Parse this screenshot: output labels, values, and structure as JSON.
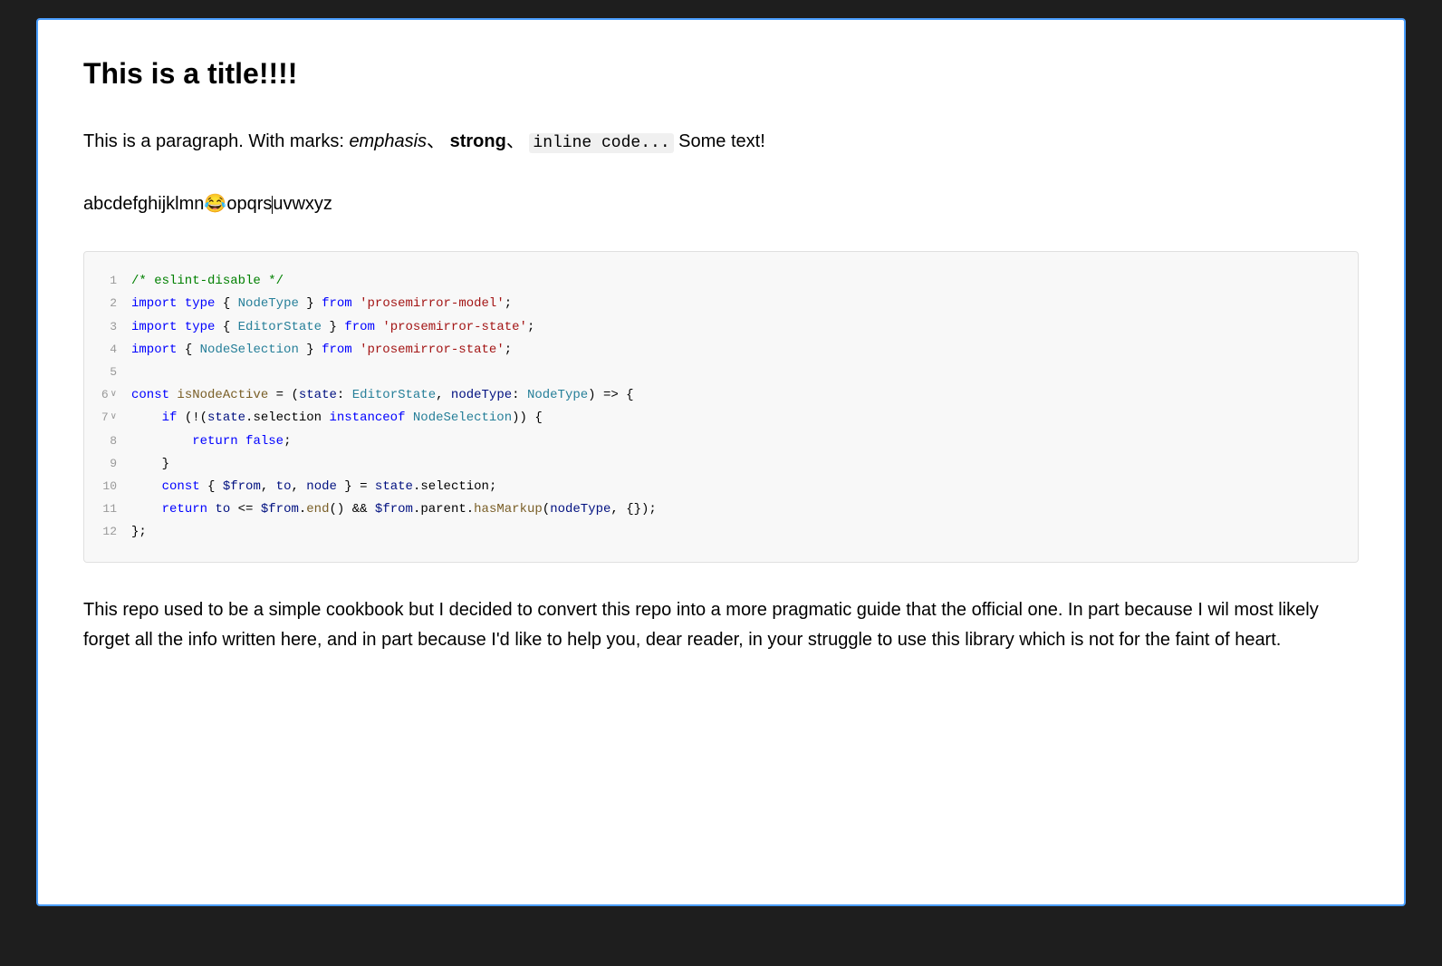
{
  "editor": {
    "title": "This is a title!!!!",
    "paragraph": {
      "prefix": "This is a paragraph. With marks: ",
      "emphasis": "emphasis",
      "comma1": "、",
      "strong": "strong",
      "comma2": "、",
      "inline_code": "inline code...",
      "suffix": " Some text!"
    },
    "alphabet": {
      "prefix": "abcdefghijklmn",
      "emoji": "😂",
      "suffix": "opqrs",
      "cursor_pos": true,
      "rest": "uvwxyz"
    },
    "code_block": {
      "lines": [
        {
          "number": "1",
          "content": "/* eslint-disable */"
        },
        {
          "number": "2",
          "content": "import type { NodeType } from 'prosemirror-model';"
        },
        {
          "number": "3",
          "content": "import type { EditorState } from 'prosemirror-state';"
        },
        {
          "number": "4",
          "content": "import { NodeSelection } from 'prosemirror-state';"
        },
        {
          "number": "5",
          "content": ""
        },
        {
          "number": "6",
          "content": "const isNodeActive = (state: EditorState, nodeType: NodeType) => {",
          "foldable": true
        },
        {
          "number": "7",
          "content": "  if (!(state.selection instanceof NodeSelection)) {",
          "foldable": true
        },
        {
          "number": "8",
          "content": "    return false;"
        },
        {
          "number": "9",
          "content": "  }"
        },
        {
          "number": "10",
          "content": "  const { $from, to, node } = state.selection;"
        },
        {
          "number": "11",
          "content": "  return to <= $from.end() && $from.parent.hasMarkup(nodeType, {});"
        },
        {
          "number": "12",
          "content": "};"
        }
      ]
    },
    "bottom_paragraph": "This repo used to be a simple cookbook but I decided to convert this repo into a more pragmatic guide that the official one. In part because I wil most likely forget all the info written here, and in part because I'd like to help you, dear reader, in your struggle to use this library which is not for the faint of heart."
  }
}
